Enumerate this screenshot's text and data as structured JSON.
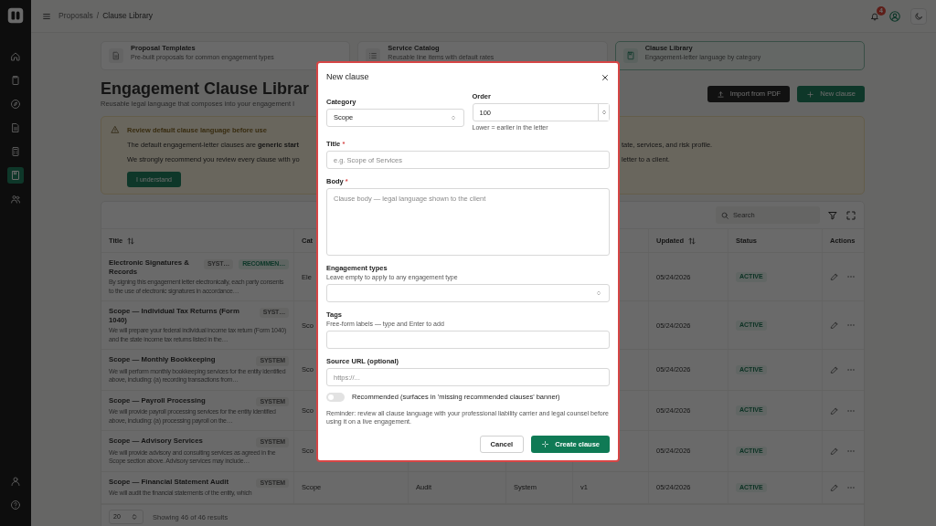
{
  "sidebar": {
    "items": [
      {
        "selected": false
      },
      {
        "selected": false
      },
      {
        "selected": false
      },
      {
        "selected": false
      },
      {
        "selected": false
      },
      {
        "selected": true
      },
      {
        "selected": false
      }
    ]
  },
  "topbar": {
    "breadcrumb": [
      "Proposals",
      "Clause Library"
    ],
    "separator": "/",
    "notification_count": "4"
  },
  "tabs": [
    {
      "title": "Proposal Templates",
      "subtitle": "Pre-built proposals for common engagement types",
      "selected": false
    },
    {
      "title": "Service Catalog",
      "subtitle": "Reusable line items with default rates",
      "selected": false
    },
    {
      "title": "Clause Library",
      "subtitle": "Engagement-letter language by category",
      "selected": true
    }
  ],
  "page": {
    "title": "Engagement Clause Librar",
    "subtitle": "Reusable legal language that composes into your engagement l",
    "buttons": [
      {
        "label": "Import from PDF",
        "kind": "dark"
      },
      {
        "label": "New clause",
        "kind": "primary"
      }
    ]
  },
  "alert": {
    "title": "Review default clause language before use",
    "paragraphs": [
      {
        "left": "The default engagement-letter clauses are **generic start**",
        "right": "tate, services, and risk profile."
      },
      {
        "left": "We strongly recommend you review every clause with yo",
        "right": "letter to a client."
      }
    ],
    "button": "I understand"
  },
  "table": {
    "search": {
      "placeholder": "Search"
    },
    "columns": {
      "title": {
        "label": "Title",
        "sortable": true
      },
      "category": {
        "label": "Cat",
        "sortable": false
      },
      "updated": {
        "label": "Updated",
        "sortable": true
      },
      "status": {
        "label": "Status",
        "sortable": false
      },
      "actions": {
        "label": "Actions",
        "sortable": false
      }
    },
    "rows": [
      {
        "title": "Electronic Signatures & Records",
        "badges": [
          {
            "label": "SYST…",
            "kind": "system"
          },
          {
            "label": "RECOMMEN…",
            "kind": "recommended"
          }
        ],
        "description": "By signing this engagement letter electronically, each party consents to the use of electronic signatures in accordance…",
        "category": "Ele",
        "updated": "05/24/2026",
        "status": "ACTIVE"
      },
      {
        "title": "Scope — Individual Tax Returns (Form 1040)",
        "badges": [
          {
            "label": "SYST…",
            "kind": "system"
          }
        ],
        "description": "We will prepare your federal individual income tax return (Form 1040) and the state income tax returns listed in the…",
        "category": "Sco",
        "updated": "05/24/2026",
        "status": "ACTIVE"
      },
      {
        "title": "Scope — Monthly Bookkeeping",
        "badges": [
          {
            "label": "SYSTEM",
            "kind": "system"
          }
        ],
        "description": "We will perform monthly bookkeeping services for the entity identified above, including: (a) recording transactions from…",
        "category": "Sco",
        "updated": "05/24/2026",
        "status": "ACTIVE"
      },
      {
        "title": "Scope — Payroll Processing",
        "badges": [
          {
            "label": "SYSTEM",
            "kind": "system"
          }
        ],
        "description": "We will provide payroll processing services for the entity identified above, including: (a) processing payroll on the…",
        "category": "Sco",
        "updated": "05/24/2026",
        "status": "ACTIVE"
      },
      {
        "title": "Scope — Advisory Services",
        "badges": [
          {
            "label": "SYSTEM",
            "kind": "system"
          }
        ],
        "description": "We will provide advisory and consulting services as agreed in the Scope section above. Advisory services may include…",
        "category": "Sco",
        "updated": "05/24/2026",
        "status": "ACTIVE"
      },
      {
        "title": "Scope — Financial Statement Audit",
        "badges": [
          {
            "label": "SYSTEM",
            "kind": "system"
          }
        ],
        "description": "We will audit the financial statements of the entity, which",
        "category": "Scope",
        "column_3": "Audit",
        "column_4": "System",
        "column_5": "v1",
        "updated": "05/24/2026",
        "status": "ACTIVE"
      }
    ],
    "page_size": "20",
    "summary": "Showing 46 of 46 results"
  },
  "modal": {
    "title": "New clause",
    "fields": [
      {
        "kind": "select",
        "label": "Category",
        "value": "Scope"
      },
      {
        "kind": "number",
        "label": "Order",
        "value": "100",
        "hint": "Lower = earlier in the letter"
      },
      {
        "kind": "text",
        "label": "Title",
        "required_mark": "*",
        "placeholder": "e.g. Scope of Services"
      },
      {
        "kind": "textarea",
        "label": "Body",
        "required_mark": "*",
        "placeholder": "Clause body — legal language shown to the client"
      },
      {
        "kind": "select",
        "label": "Engagement types",
        "note": "Leave empty to apply to any engagement type"
      },
      {
        "kind": "text",
        "label": "Tags",
        "note": "Free-form labels — type and Enter to add"
      },
      {
        "kind": "text",
        "label": "Source URL (optional)",
        "placeholder": "https://..."
      },
      {
        "kind": "switch",
        "label": "Recommended (surfaces in 'missing recommended clauses' banner)",
        "on": false
      }
    ],
    "reminder": "Reminder: review all clause language with your professional liability carrier and legal counsel before using it on a live engagement.",
    "buttons": [
      {
        "label": "Cancel",
        "kind": "secondary"
      },
      {
        "label": "Create clause",
        "kind": "primary"
      }
    ]
  }
}
